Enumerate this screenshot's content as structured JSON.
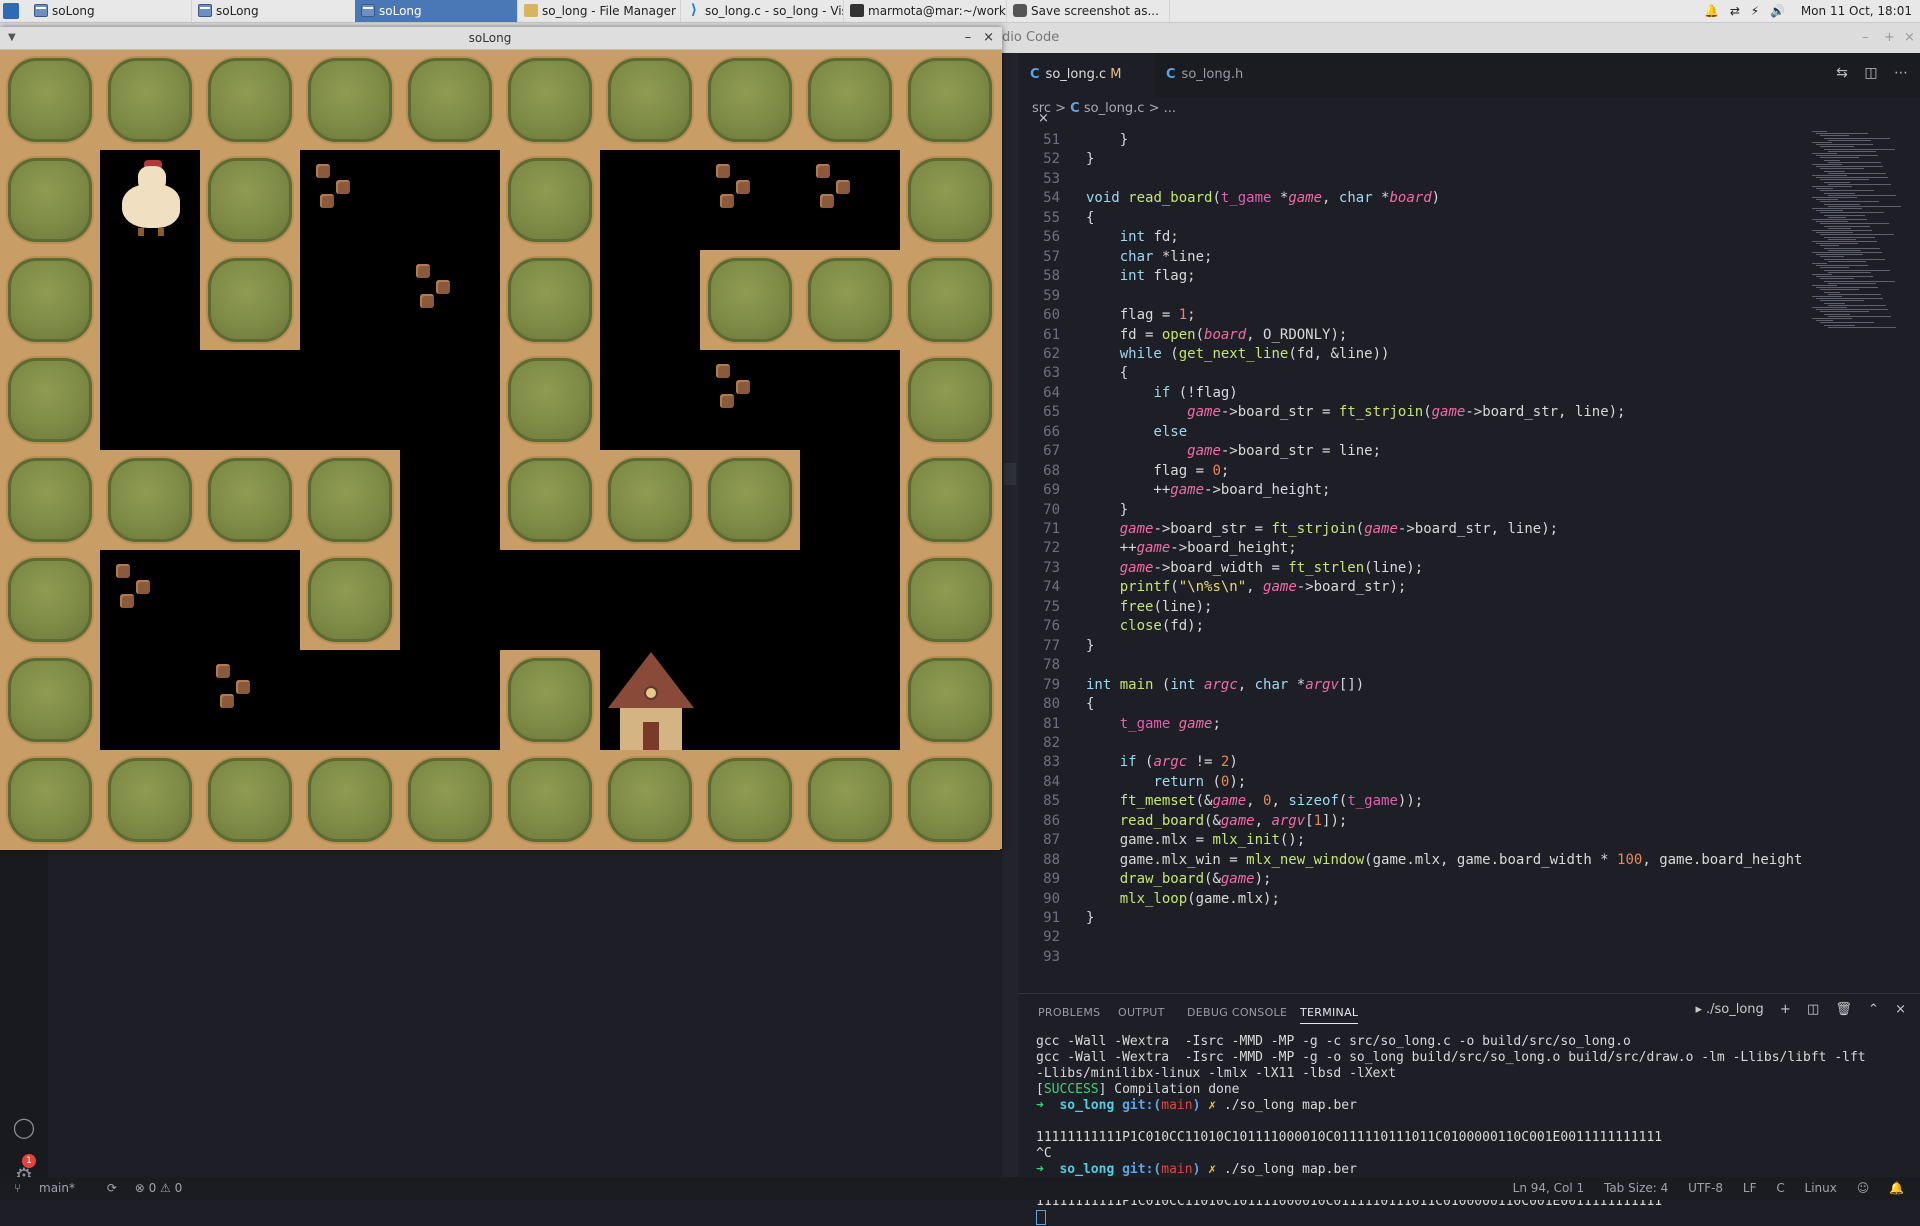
{
  "taskbar": {
    "tasks": [
      {
        "label": "soLong",
        "icon": "window-icon",
        "active": false
      },
      {
        "label": "soLong",
        "icon": "window-icon",
        "active": false
      },
      {
        "label": "soLong",
        "icon": "window-icon",
        "active": true
      },
      {
        "label": "so_long - File Manager",
        "icon": "folder-icon",
        "active": false
      },
      {
        "label": "so_long.c - so_long - Visual S...",
        "icon": "vscode-icon",
        "active": false
      },
      {
        "label": "marmota@mar:~/workstati...",
        "icon": "terminal-icon",
        "active": false
      },
      {
        "label": "Save screenshot as...",
        "icon": "screenshot-icon",
        "active": false
      }
    ],
    "clock": "Mon 11 Oct, 18:01"
  },
  "vscode": {
    "title_fragment": "dio Code",
    "tabs": [
      {
        "c": "C",
        "label": "so_long.c",
        "modified": "M",
        "close": "×"
      },
      {
        "c": "C",
        "label": "so_long.h"
      }
    ],
    "breadcrumb": {
      "folder": "src",
      "sep": ">",
      "c": "C",
      "file": "so_long.c",
      "more": "..."
    },
    "panel_tabs": [
      "PROBLEMS",
      "OUTPUT",
      "DEBUG CONSOLE",
      "TERMINAL"
    ],
    "terminal_name": "./so_long",
    "terminal": {
      "l1": "gcc -Wall -Wextra  -Isrc -MMD -MP -g -c src/so_long.c -o build/src/so_long.o",
      "l2": "gcc -Wall -Wextra  -Isrc -MMD -MP -g -o so_long build/src/so_long.o build/src/draw.o -lm -Llibs/libft -lft",
      "l3": "-Llibs/minilibx-linux -lmlx -lX11 -lbsd -lXext",
      "success": "SUCCESS",
      "l4_rest": "] Compilation done",
      "prompt_dir": "so_long",
      "prompt_git": "git:(",
      "prompt_branch": "main",
      "prompt_close": ")",
      "prompt_x": "✗",
      "cmd": "./so_long map.ber",
      "out": "11111111111P1C010CC11010C101111000010C0111110111011C0100000110C001E0011111111111",
      "ctrl_c": "^C"
    },
    "status": {
      "branch": "main*",
      "problems": "⊗ 0 ⚠ 0",
      "cursor": "Ln 94, Col 1",
      "tab_size": "Tab Size: 4",
      "encoding": "UTF-8",
      "eol": "LF",
      "language": "C",
      "os": "Linux"
    }
  },
  "code_lines": [
    {
      "n": "51",
      "t": "    }"
    },
    {
      "n": "52",
      "t": "}"
    },
    {
      "n": "53",
      "t": ""
    },
    {
      "n": "54",
      "t": "void read_board(t_game *game, char *board)"
    },
    {
      "n": "55",
      "t": "{"
    },
    {
      "n": "56",
      "t": "    int fd;"
    },
    {
      "n": "57",
      "t": "    char *line;"
    },
    {
      "n": "58",
      "t": "    int flag;"
    },
    {
      "n": "59",
      "t": ""
    },
    {
      "n": "60",
      "t": "    flag = 1;"
    },
    {
      "n": "61",
      "t": "    fd = open(board, O_RDONLY);"
    },
    {
      "n": "62",
      "t": "    while (get_next_line(fd, &line))"
    },
    {
      "n": "63",
      "t": "    {"
    },
    {
      "n": "64",
      "t": "        if (!flag)"
    },
    {
      "n": "65",
      "t": "            game->board_str = ft_strjoin(game->board_str, line);"
    },
    {
      "n": "66",
      "t": "        else"
    },
    {
      "n": "67",
      "t": "            game->board_str = line;"
    },
    {
      "n": "68",
      "t": "        flag = 0;"
    },
    {
      "n": "69",
      "t": "        ++game->board_height;"
    },
    {
      "n": "70",
      "t": "    }"
    },
    {
      "n": "71",
      "t": "    game->board_str = ft_strjoin(game->board_str, line);"
    },
    {
      "n": "72",
      "t": "    ++game->board_height;"
    },
    {
      "n": "73",
      "t": "    game->board_width = ft_strlen(line);"
    },
    {
      "n": "74",
      "t": "    printf(\"\\n%s\\n\", game->board_str);"
    },
    {
      "n": "75",
      "t": "    free(line);"
    },
    {
      "n": "76",
      "t": "    close(fd);"
    },
    {
      "n": "77",
      "t": "}"
    },
    {
      "n": "78",
      "t": ""
    },
    {
      "n": "79",
      "t": "int main (int argc, char *argv[])"
    },
    {
      "n": "80",
      "t": "{"
    },
    {
      "n": "81",
      "t": "    t_game game;"
    },
    {
      "n": "82",
      "t": ""
    },
    {
      "n": "83",
      "t": "    if (argc != 2)"
    },
    {
      "n": "84",
      "t": "        return (0);"
    },
    {
      "n": "85",
      "t": "    ft_memset(&game, 0, sizeof(t_game));"
    },
    {
      "n": "86",
      "t": "    read_board(&game, argv[1]);"
    },
    {
      "n": "87",
      "t": "    game.mlx = mlx_init();"
    },
    {
      "n": "88",
      "t": "    game.mlx_win = mlx_new_window(game.mlx, game.board_width * 100, game.board_height"
    },
    {
      "n": "89",
      "t": "    draw_board(&game);"
    },
    {
      "n": "90",
      "t": "    mlx_loop(game.mlx);"
    },
    {
      "n": "91",
      "t": "}"
    },
    {
      "n": "92",
      "t": ""
    },
    {
      "n": "93",
      "t": ""
    }
  ],
  "game": {
    "title": "soLong",
    "map_rows": [
      "1111111111",
      "1P1C010CC1",
      "1010C10111",
      "1000010C01",
      "1111011101",
      "1C01000001",
      "10C001E001",
      "1111111111"
    ]
  }
}
